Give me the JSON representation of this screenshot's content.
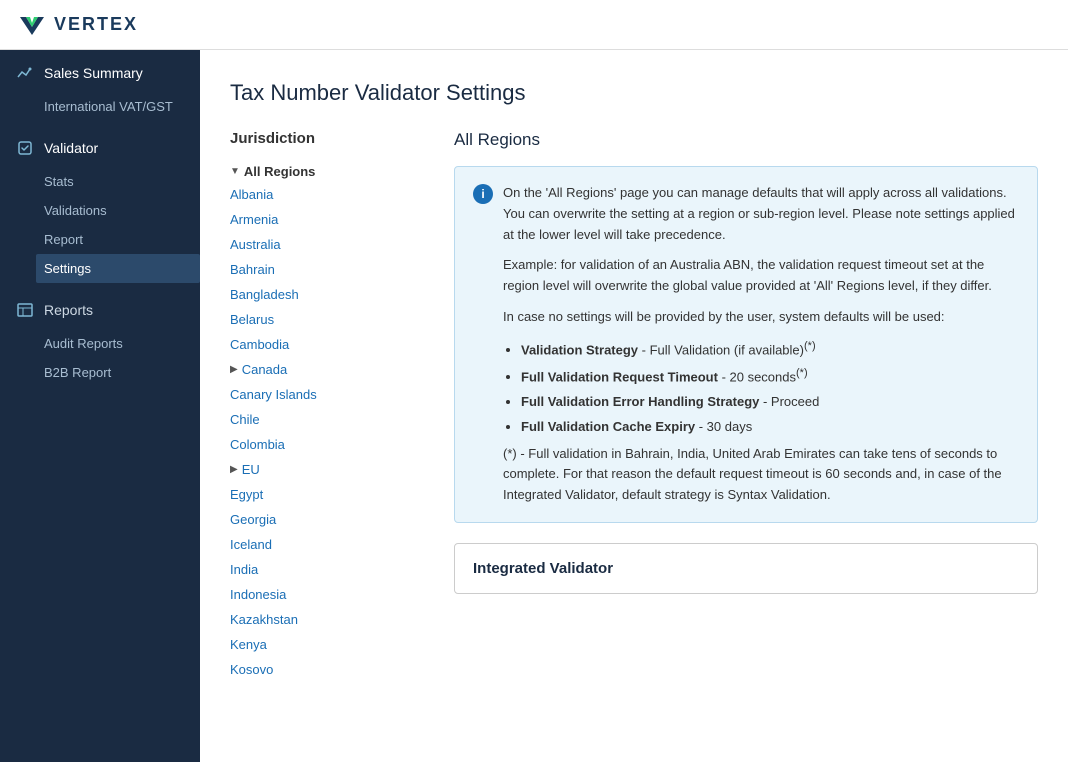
{
  "header": {
    "logo_text": "VERTEX",
    "logo_icon": "V"
  },
  "sidebar": {
    "sections": [
      {
        "id": "sales-summary",
        "icon": "chart",
        "label": "Sales Summary",
        "sub_items": [
          {
            "id": "intl-vat",
            "label": "International VAT/GST",
            "active": false
          }
        ]
      },
      {
        "id": "validator",
        "icon": "badge",
        "label": "Validator",
        "sub_items": [
          {
            "id": "stats",
            "label": "Stats",
            "active": false
          },
          {
            "id": "validations",
            "label": "Validations",
            "active": false
          },
          {
            "id": "report",
            "label": "Report",
            "active": false
          },
          {
            "id": "settings",
            "label": "Settings",
            "active": true
          }
        ]
      },
      {
        "id": "reports",
        "icon": "table",
        "label": "Reports",
        "sub_items": [
          {
            "id": "audit-reports",
            "label": "Audit Reports",
            "active": false
          },
          {
            "id": "b2b-report",
            "label": "B2B Report",
            "active": false
          }
        ]
      }
    ]
  },
  "page": {
    "title": "Tax Number Validator Settings",
    "jurisdiction_heading": "Jurisdiction",
    "region_heading": "All Regions"
  },
  "jurisdiction": {
    "items": [
      {
        "id": "all-regions",
        "label": "All Regions",
        "type": "parent-expanded",
        "arrow": "▼"
      },
      {
        "id": "albania",
        "label": "Albania",
        "type": "child"
      },
      {
        "id": "armenia",
        "label": "Armenia",
        "type": "child"
      },
      {
        "id": "australia",
        "label": "Australia",
        "type": "child"
      },
      {
        "id": "bahrain",
        "label": "Bahrain",
        "type": "child"
      },
      {
        "id": "bangladesh",
        "label": "Bangladesh",
        "type": "child"
      },
      {
        "id": "belarus",
        "label": "Belarus",
        "type": "child"
      },
      {
        "id": "cambodia",
        "label": "Cambodia",
        "type": "child"
      },
      {
        "id": "canada",
        "label": "Canada",
        "type": "parent-collapsed",
        "arrow": "▶"
      },
      {
        "id": "canary-islands",
        "label": "Canary Islands",
        "type": "child"
      },
      {
        "id": "chile",
        "label": "Chile",
        "type": "child"
      },
      {
        "id": "colombia",
        "label": "Colombia",
        "type": "child"
      },
      {
        "id": "eu",
        "label": "EU",
        "type": "parent-collapsed",
        "arrow": "▶"
      },
      {
        "id": "egypt",
        "label": "Egypt",
        "type": "child"
      },
      {
        "id": "georgia",
        "label": "Georgia",
        "type": "child"
      },
      {
        "id": "iceland",
        "label": "Iceland",
        "type": "child"
      },
      {
        "id": "india",
        "label": "India",
        "type": "child"
      },
      {
        "id": "indonesia",
        "label": "Indonesia",
        "type": "child"
      },
      {
        "id": "kazakhstan",
        "label": "Kazakhstan",
        "type": "child"
      },
      {
        "id": "kenya",
        "label": "Kenya",
        "type": "child"
      },
      {
        "id": "kosovo",
        "label": "Kosovo",
        "type": "child"
      }
    ]
  },
  "info_box": {
    "intro": "On the 'All Regions' page you can manage defaults that will apply across all validations. You can overwrite the setting at a region or sub-region level. Please note settings applied at the lower level will take precedence.",
    "example": "Example: for validation of an Australia ABN, the validation request timeout set at the region level will overwrite the global value provided at 'All' Regions level, if they differ.",
    "system_default_intro": "In case no settings will be provided by the user, system defaults will be used:",
    "defaults": [
      {
        "id": "validation-strategy",
        "bold": "Validation Strategy",
        "text": " - Full Validation (if available)",
        "footnote": "(*)"
      },
      {
        "id": "timeout",
        "bold": "Full Validation Request Timeout",
        "text": " - 20 seconds",
        "footnote": "(*)"
      },
      {
        "id": "error-handling",
        "bold": "Full Validation Error Handling Strategy",
        "text": " - Proceed",
        "footnote": ""
      },
      {
        "id": "cache-expiry",
        "bold": "Full Validation Cache Expiry",
        "text": " - 30 days",
        "footnote": ""
      }
    ],
    "footnote_text": "(*) - Full validation in Bahrain, India, United Arab Emirates can take tens of seconds to complete. For that reason the default request timeout is 60 seconds and, in case of the Integrated Validator, default strategy is Syntax Validation."
  },
  "integrated_validator": {
    "title": "Integrated Validator"
  }
}
